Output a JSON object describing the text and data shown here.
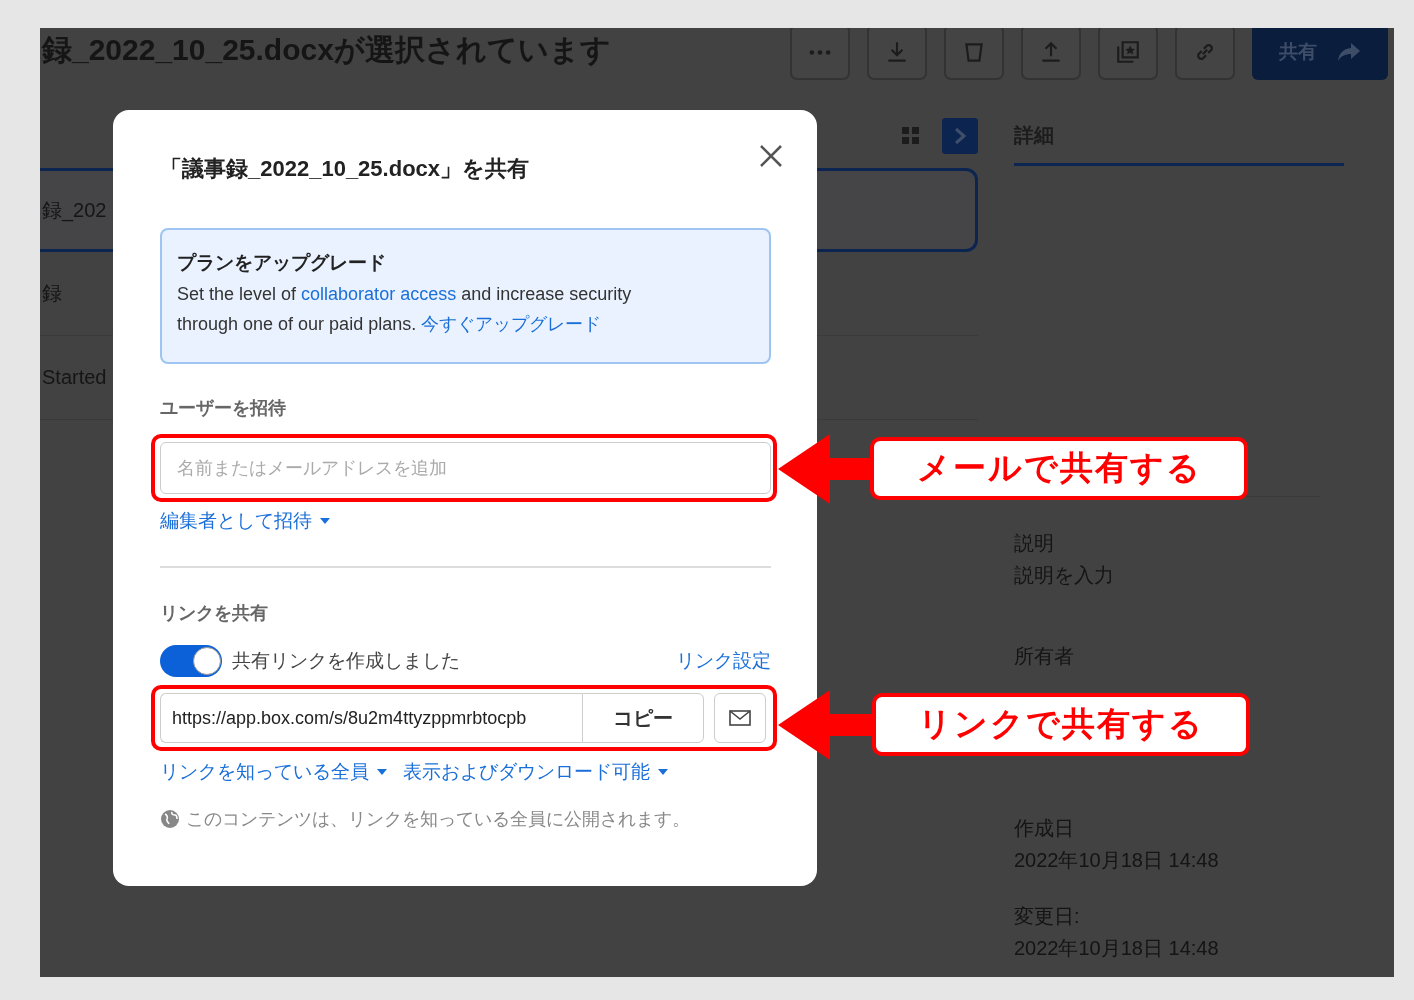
{
  "app": {
    "title": "録_2022_10_25.docxが選択されています",
    "toolbar": [
      {
        "kind": "more"
      },
      {
        "kind": "download"
      },
      {
        "kind": "trash"
      },
      {
        "kind": "upload"
      },
      {
        "kind": "collection"
      },
      {
        "kind": "link"
      }
    ],
    "share_button": "共有",
    "file_rows": [
      {
        "name": "録_202",
        "selected": true
      },
      {
        "name": "録",
        "selected": false
      },
      {
        "name": "Started",
        "selected": false
      }
    ]
  },
  "details": {
    "tab": "詳細",
    "fields": [
      {
        "label": "説明",
        "value": "説明を入力"
      },
      {
        "label": "所有者"
      },
      {
        "label": "作成日",
        "value": "2022年10月18日 14:48"
      },
      {
        "label": "変更日:",
        "value": "2022年10月18日 14:48"
      }
    ]
  },
  "dialog": {
    "title": "「議事録_2022_10_25.docx」を共有",
    "upgrade": {
      "heading": "プランをアップグレード",
      "text_before": "Set the level of ",
      "link": "collaborator access",
      "text_after": " and increase security through one of our paid plans. ",
      "cta": "今すぐアップグレード"
    },
    "invite": {
      "heading": "ユーザーを招待",
      "placeholder": "名前またはメールアドレスを追加",
      "role": "編集者として招待"
    },
    "share_link": {
      "heading": "リンクを共有",
      "enabled": true,
      "status": "共有リンクを作成しました",
      "settings": "リンク設定",
      "url": "https://app.box.com/s/8u2m4ttyzppmrbtocpb",
      "copy": "コピー",
      "access": "リンクを知っている全員",
      "permission": "表示およびダウンロード可能",
      "note": "このコンテンツは、リンクを知っている全員に公開されます。"
    }
  },
  "annotations": [
    {
      "text": "メールで共有する"
    },
    {
      "text": "リンクで共有する"
    }
  ]
}
